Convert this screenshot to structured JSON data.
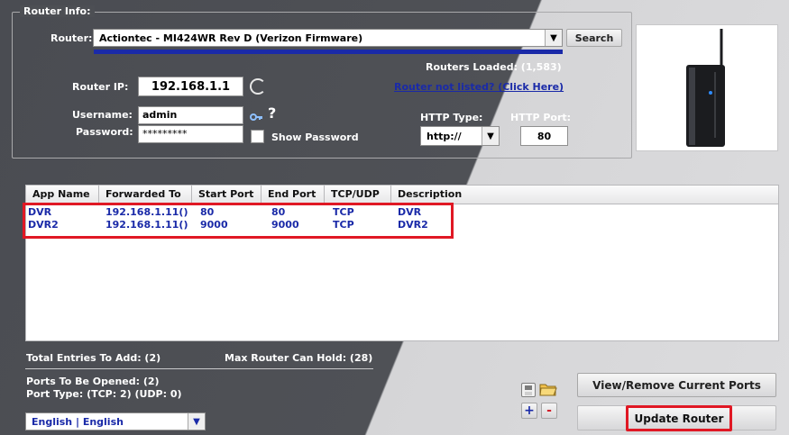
{
  "router_info": {
    "group_title": "Router Info:",
    "router_label": "Router:",
    "router_value": "Actiontec - MI424WR Rev D (Verizon Firmware)",
    "search_label": "Search",
    "routers_loaded": "Routers Loaded: (1,583)",
    "router_ip_label": "Router IP:",
    "router_ip_value": "192.168.1.1",
    "router_not_listed": "Router not listed? (Click Here)",
    "username_label": "Username:",
    "username_value": "admin",
    "password_label": "Password:",
    "password_value": "*********",
    "show_password_label": "Show Password",
    "http_type_label": "HTTP Type:",
    "http_type_value": "http://",
    "http_port_label": "HTTP Port:",
    "http_port_value": "80",
    "help_glyph": "?"
  },
  "table": {
    "columns": [
      "App Name",
      "Forwarded To",
      "Start Port",
      "End Port",
      "TCP/UDP",
      "Description"
    ],
    "rows": [
      [
        "DVR",
        "192.168.1.11()",
        "80",
        "80",
        "TCP",
        "DVR"
      ],
      [
        "DVR2",
        "192.168.1.11()",
        "9000",
        "9000",
        "TCP",
        "DVR2"
      ]
    ]
  },
  "footer": {
    "total_entries": "Total Entries To Add: (2)",
    "max_hold": "Max Router Can Hold: (28)",
    "ports_opened": "Ports To Be Opened: (2)",
    "port_type": "Port Type: (TCP: 2) (UDP: 0)",
    "language_value": "English | English",
    "view_remove_label": "View/Remove Current Ports",
    "update_router_label": "Update Router",
    "add_glyph": "+",
    "remove_glyph": "-"
  },
  "icons": {
    "refresh": "refresh-icon",
    "key": "key-icon",
    "help": "help-icon",
    "save": "save-icon",
    "open": "open-folder-icon",
    "add": "add-icon",
    "remove": "remove-icon",
    "router_image": "router-image"
  },
  "colors": {
    "accent_blue": "#1a2aa8",
    "highlight_red": "#e01824",
    "panel_dark": "#4f5156",
    "panel_light": "#dcdcde"
  }
}
